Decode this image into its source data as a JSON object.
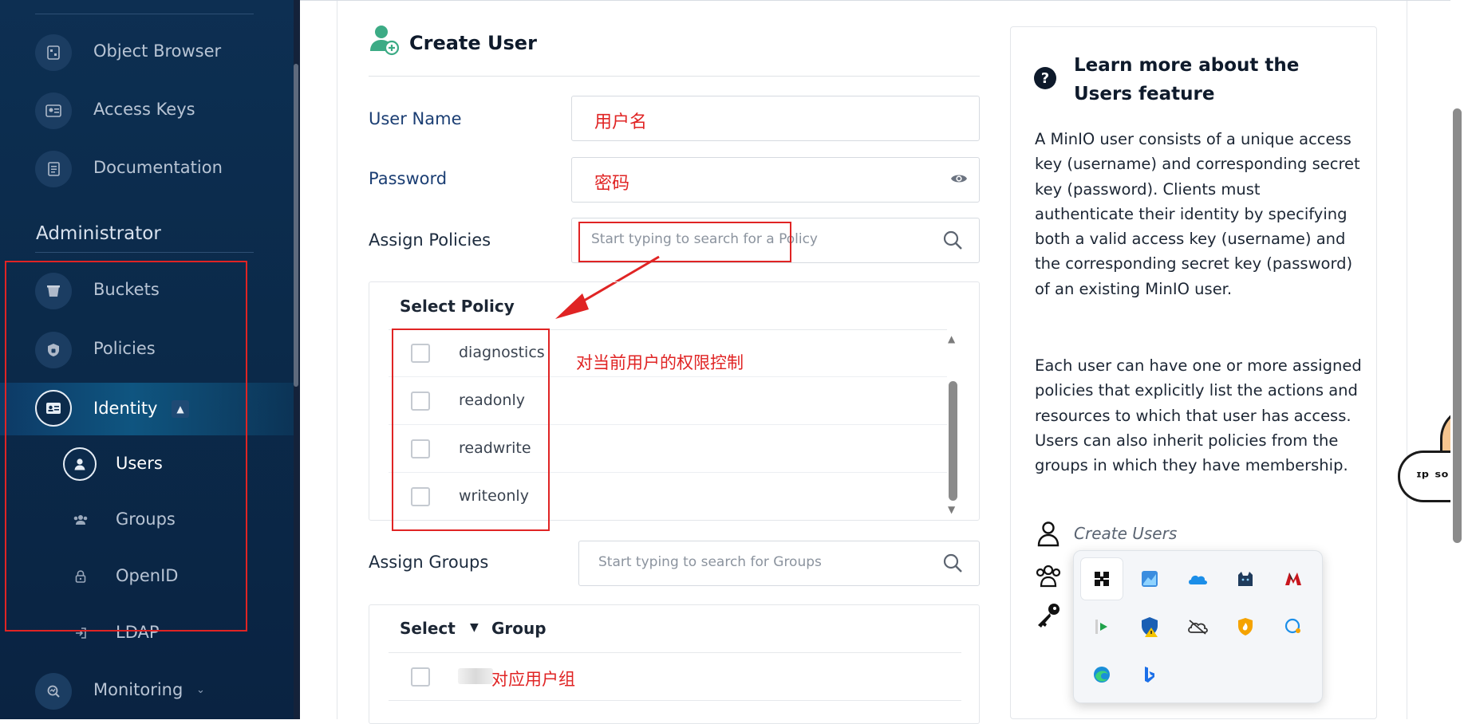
{
  "sidebar": {
    "items_top": [
      {
        "label": "Object Browser",
        "icon": "object-browser-icon"
      },
      {
        "label": "Access Keys",
        "icon": "access-keys-icon"
      },
      {
        "label": "Documentation",
        "icon": "documentation-icon"
      }
    ],
    "section_admin": "Administrator",
    "items_admin": [
      {
        "label": "Buckets",
        "icon": "bucket-icon"
      },
      {
        "label": "Policies",
        "icon": "shield-icon"
      },
      {
        "label": "Identity",
        "icon": "id-card-icon"
      }
    ],
    "identity_sub": [
      {
        "label": "Users",
        "icon": "user-icon"
      },
      {
        "label": "Groups",
        "icon": "group-icon"
      },
      {
        "label": "OpenID",
        "icon": "lock-icon"
      },
      {
        "label": "LDAP",
        "icon": "login-icon"
      }
    ],
    "monitoring": {
      "label": "Monitoring",
      "icon": "monitoring-icon"
    }
  },
  "form": {
    "title": "Create User",
    "user_name_label": "User Name",
    "user_name_value": "用户名",
    "password_label": "Password",
    "password_value": "密码",
    "policies_label": "Assign Policies",
    "policies_placeholder": "Start typing to search for a Policy",
    "policy_table_header": "Select  Policy",
    "policies": [
      "diagnostics",
      "readonly",
      "readwrite",
      "writeonly"
    ],
    "groups_label": "Assign Groups",
    "groups_placeholder": "Start typing to search for Groups",
    "group_header_select": "Select",
    "group_header_group": "Group"
  },
  "annotations": {
    "policy_note": "对当前用户的权限控制",
    "group_note": "对应用户组"
  },
  "help": {
    "title": "Learn more about the Users feature",
    "para1": "A MinIO user consists of a unique access key (username) and corresponding secret key (password). Clients must authenticate their identity by specifying both a valid access key (username) and the corresponding secret key (password) of an existing MinIO user.",
    "para2": "Each user can have one or more assigned policies that explicitly list the actions and resources to which that user has access. Users can also inherit policies from the groups in which they have membership.",
    "link_create": "Create Users"
  },
  "colors": {
    "sidebar_bg": "#0b2a4a",
    "annotation_red": "#e02424",
    "accent_green": "#3cab85"
  }
}
